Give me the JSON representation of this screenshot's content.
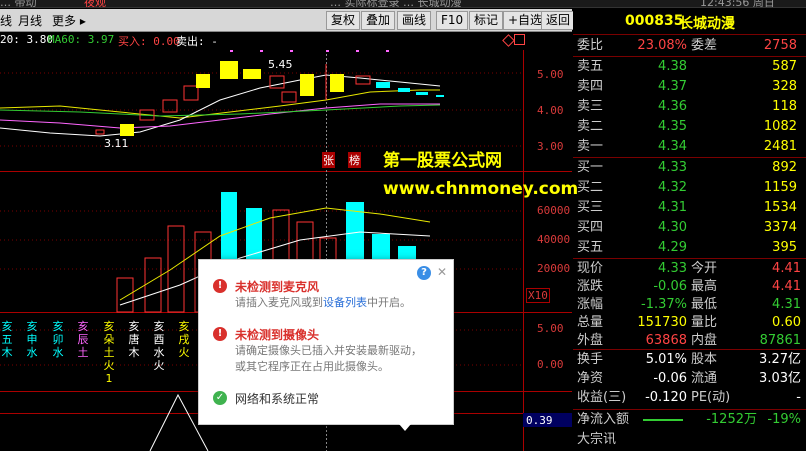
{
  "topbar": {
    "left": "… 带动",
    "tag": "夜观",
    "center": "… 实际标登录 … 长城动漫",
    "right": "12:43:56 周日"
  },
  "toolbar": {
    "left_items": [
      "线",
      "月线",
      "更多 ▸"
    ],
    "buttons": [
      "复权",
      "叠加",
      "画线",
      "F10",
      "标记",
      "+自选",
      "返回"
    ]
  },
  "indicators": {
    "ma20": "20: 3.80",
    "ma60": "MA60: 3.97",
    "buy_in": "买入: 0.00",
    "sell_out": "卖出: -"
  },
  "price_axis": [
    "5.00",
    "4.00",
    "3.00"
  ],
  "volume_axis": [
    "60000",
    "40000",
    "20000"
  ],
  "volume_unit": "X10",
  "lower_axis": [
    "5.00",
    "0.00"
  ],
  "bottom_value": "0.39",
  "annotations": {
    "high": "5.45",
    "low": "3.11",
    "limit_tag_1": "张",
    "limit_tag_2": "榜"
  },
  "watermark": {
    "line1": "第一股票公式网",
    "line2": "www.chnmoney.com"
  },
  "kline_markers": [
    "亥五木",
    "亥申水",
    "亥卯水",
    "亥辰土",
    "亥朵土火1",
    "亥唐木",
    "亥酉水火",
    "亥戌火"
  ],
  "stock": {
    "code": "000835",
    "name": "长城动漫"
  },
  "quote": {
    "weibi_label": "委比",
    "weibi_value": "23.08%",
    "weicha_label": "委差",
    "weicha_value": "2758",
    "sell": [
      {
        "label": "卖五",
        "price": "4.38",
        "vol": "587"
      },
      {
        "label": "卖四",
        "price": "4.37",
        "vol": "328"
      },
      {
        "label": "卖三",
        "price": "4.36",
        "vol": "118"
      },
      {
        "label": "卖二",
        "price": "4.35",
        "vol": "1082"
      },
      {
        "label": "卖一",
        "price": "4.34",
        "vol": "2481"
      }
    ],
    "buy": [
      {
        "label": "买一",
        "price": "4.33",
        "vol": "892"
      },
      {
        "label": "买二",
        "price": "4.32",
        "vol": "1159"
      },
      {
        "label": "买三",
        "price": "4.31",
        "vol": "1534"
      },
      {
        "label": "买四",
        "price": "4.30",
        "vol": "3374"
      },
      {
        "label": "买五",
        "price": "4.29",
        "vol": "395"
      }
    ],
    "stats": [
      {
        "l1": "现价",
        "v1": "4.33",
        "l2": "今开",
        "v2": "4.41"
      },
      {
        "l1": "涨跌",
        "v1": "-0.06",
        "l2": "最高",
        "v2": "4.41"
      },
      {
        "l1": "涨幅",
        "v1": "-1.37%",
        "l2": "最低",
        "v2": "4.31"
      },
      {
        "l1": "总量",
        "v1": "151730",
        "l2": "量比",
        "v2": "0.60"
      },
      {
        "l1": "外盘",
        "v1": "63868",
        "l2": "内盘",
        "v2": "87861"
      }
    ],
    "fund": [
      {
        "l1": "换手",
        "v1": "5.01%",
        "l2": "股本",
        "v2": "3.27亿"
      },
      {
        "l1": "净资",
        "v1": "-0.06",
        "l2": "流通",
        "v2": "3.03亿"
      },
      {
        "l1": "收益(三)",
        "v1": "-0.120",
        "l2": "PE(动)",
        "v2": "-"
      }
    ],
    "netflow_label": "净流入额",
    "netflow_value": "-1252万",
    "netflow_pct": "-19%",
    "bigdeal_label": "大宗讯"
  },
  "popup": {
    "mic_title": "未检测到麦克风",
    "mic_desc_pre": "请插入麦克风或到",
    "mic_desc_link": "设备列表",
    "mic_desc_post": "中开启。",
    "cam_title": "未检测到摄像头",
    "cam_desc_1": "请确定摄像头已插入并安装最新驱动，",
    "cam_desc_2": "或其它程序正在占用此摄像头。",
    "net_status": "网络和系统正常",
    "help": "?",
    "close": "✕"
  },
  "colors": {
    "up": "#ff3333",
    "down": "#00ffff",
    "yellow": "#ffff00",
    "ma_white": "#ffffff",
    "ma_yellow": "#e8e800",
    "ma_pink": "#ff66ff",
    "ma_green": "#33cc33"
  }
}
